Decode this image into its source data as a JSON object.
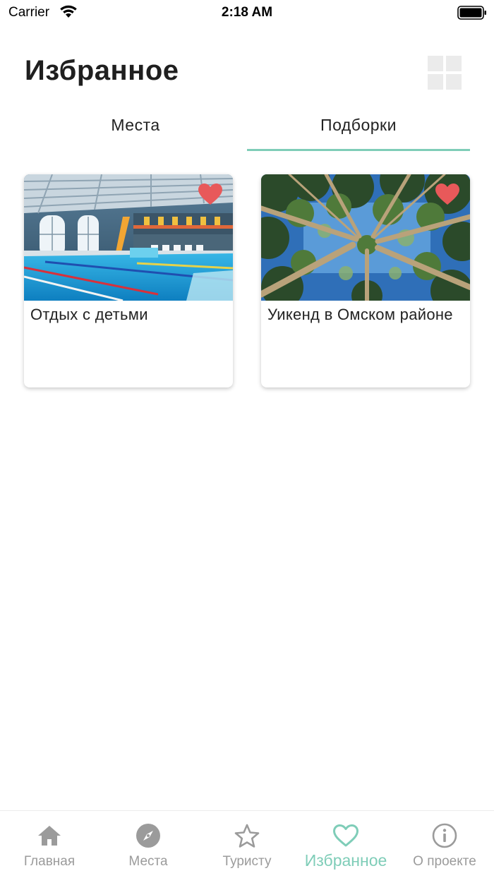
{
  "status_bar": {
    "carrier": "Carrier",
    "time": "2:18 AM"
  },
  "header": {
    "title": "Избранное",
    "view_toggle_icon": "grid-icon"
  },
  "tabs": [
    {
      "label": "Места",
      "active": false
    },
    {
      "label": "Подборки",
      "active": true
    }
  ],
  "cards": [
    {
      "title": "Отдых с детьми",
      "image": "indoor-pool-photo",
      "favorite": true
    },
    {
      "title": "Уикенд в Омском районе",
      "image": "pine-trees-sky-photo",
      "favorite": true
    }
  ],
  "bottom_nav": [
    {
      "label": "Главная",
      "icon": "home-icon",
      "active": false
    },
    {
      "label": "Места",
      "icon": "compass-icon",
      "active": false
    },
    {
      "label": "Туристу",
      "icon": "star-icon",
      "active": false
    },
    {
      "label": "Избранное",
      "icon": "heart-icon",
      "active": true
    },
    {
      "label": "О проекте",
      "icon": "info-icon",
      "active": false
    }
  ],
  "colors": {
    "accent": "#7fcdb8",
    "heart": "#e8595a",
    "inactive_nav": "#9b9b9b"
  }
}
